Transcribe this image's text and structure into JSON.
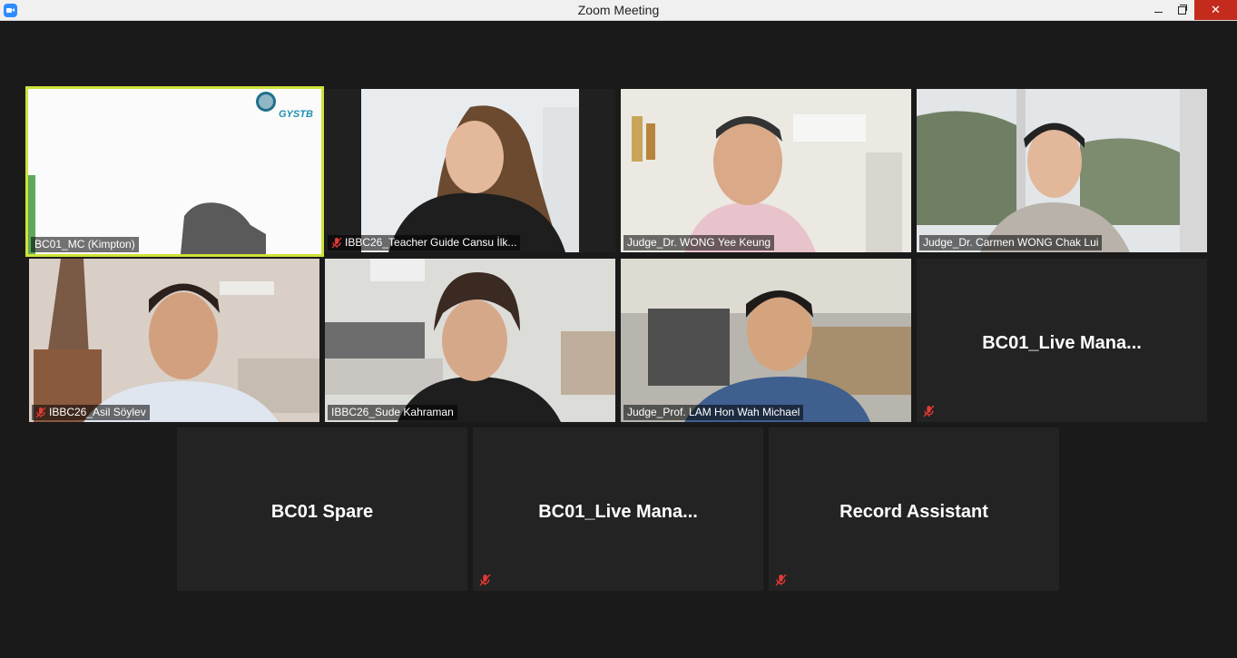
{
  "window": {
    "title": "Zoom Meeting"
  },
  "tiles": [
    {
      "name": "BC01_MC (Kimpton)",
      "muted": false,
      "logo_text": "GYSTB"
    },
    {
      "name": "IBBC26_Teacher Guide Cansu İlk...",
      "muted": true
    },
    {
      "name": "Judge_Dr. WONG Yee Keung",
      "muted": false
    },
    {
      "name": "Judge_Dr. Carmen WONG Chak Lui",
      "muted": false
    },
    {
      "name": "IBBC26_Asil Söylev",
      "muted": true
    },
    {
      "name": "IBBC26_Sude Kahraman",
      "muted": false
    },
    {
      "name": "Judge_Prof. LAM Hon Wah Michael",
      "muted": false
    },
    {
      "name": "BC01_Live  Mana...",
      "muted": true
    },
    {
      "name": "BC01 Spare",
      "muted": false
    },
    {
      "name": "BC01_Live  Mana...",
      "muted": true
    },
    {
      "name": "Record Assistant",
      "muted": true
    }
  ],
  "colors": {
    "active_speaker_border": "#cfe23a",
    "mute_red": "#e53935",
    "tile_bg": "#232323"
  }
}
